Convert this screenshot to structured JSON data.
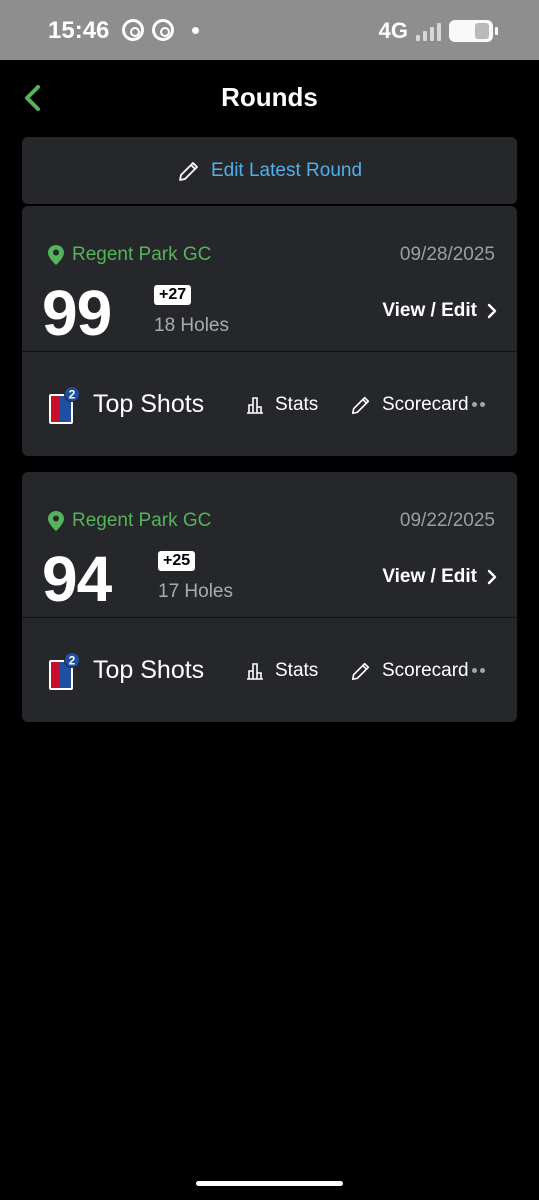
{
  "status": {
    "time": "15:46",
    "network": "4G"
  },
  "header": {
    "title": "Rounds",
    "back_icon": "chevron-left-icon"
  },
  "edit_latest": {
    "label": "Edit Latest Round"
  },
  "rounds": [
    {
      "course": "Regent Park GC",
      "date": "09/28/2025",
      "score": "99",
      "to_par": "+27",
      "holes": "18 Holes",
      "view_label": "View / Edit",
      "badge_count": "2",
      "top_shots": "Top Shots",
      "stats": "Stats",
      "scorecard": "Scorecard"
    },
    {
      "course": "Regent Park GC",
      "date": "09/22/2025",
      "score": "94",
      "to_par": "+25",
      "holes": "17 Holes",
      "view_label": "View / Edit",
      "badge_count": "2",
      "top_shots": "Top Shots",
      "stats": "Stats",
      "scorecard": "Scorecard"
    }
  ],
  "colors": {
    "accent_green": "#53b45a",
    "link_blue": "#4fb0ea",
    "card_bg": "#26272a"
  }
}
